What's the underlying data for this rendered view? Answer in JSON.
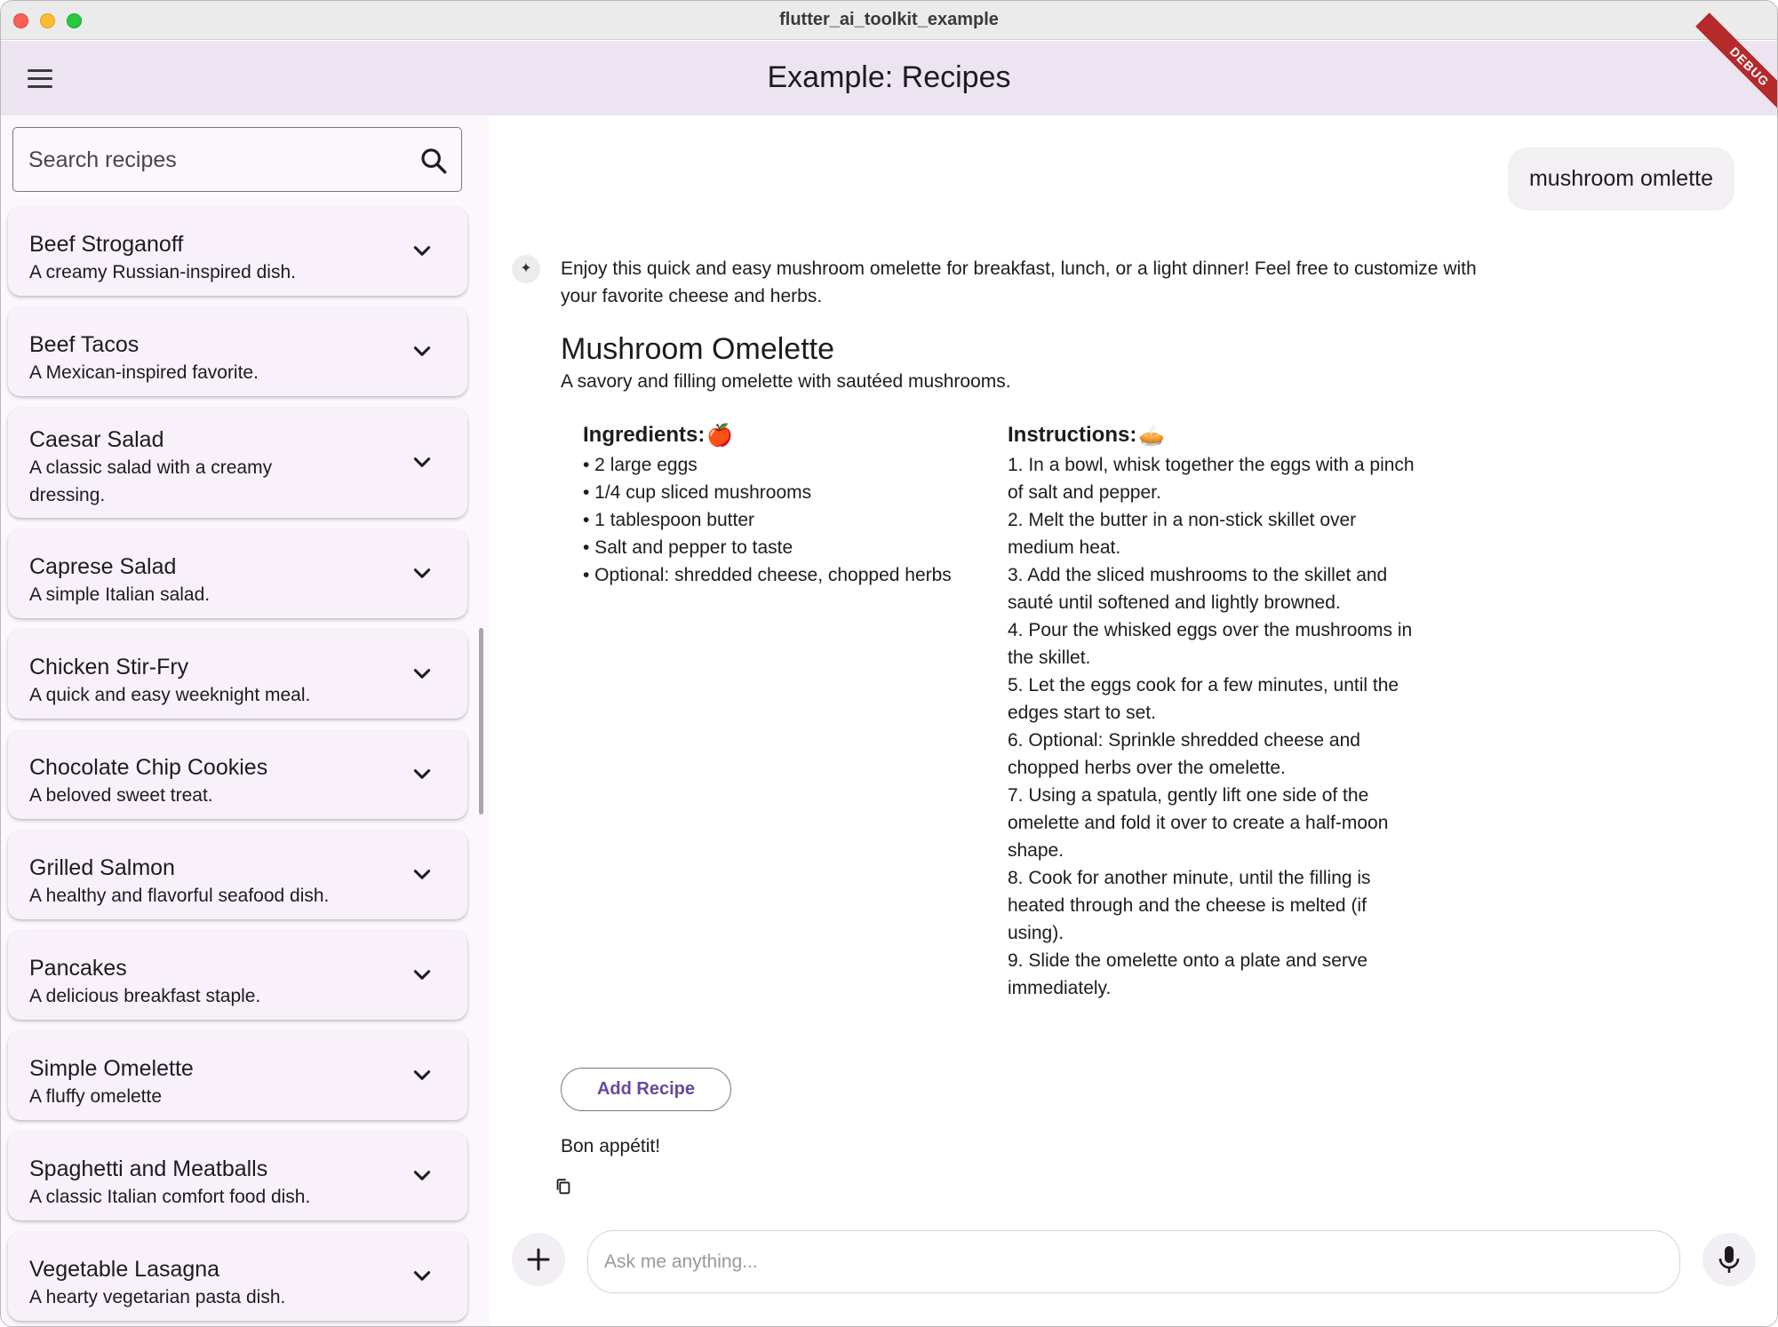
{
  "window": {
    "title": "flutter_ai_toolkit_example"
  },
  "appbar": {
    "title": "Example: Recipes",
    "debug_label": "DEBUG"
  },
  "sidebar": {
    "search_placeholder": "Search recipes",
    "recipes": [
      {
        "name": "Beef Stroganoff",
        "description": "A creamy Russian-inspired dish."
      },
      {
        "name": "Beef Tacos",
        "description": "A Mexican-inspired favorite."
      },
      {
        "name": "Caesar Salad",
        "description": "A classic salad with a creamy dressing."
      },
      {
        "name": "Caprese Salad",
        "description": "A simple Italian salad."
      },
      {
        "name": "Chicken Stir-Fry",
        "description": "A quick and easy weeknight meal."
      },
      {
        "name": "Chocolate Chip Cookies",
        "description": "A beloved sweet treat."
      },
      {
        "name": "Grilled Salmon",
        "description": "A healthy and flavorful seafood dish."
      },
      {
        "name": "Pancakes",
        "description": "A delicious breakfast staple."
      },
      {
        "name": "Simple Omelette",
        "description": "A fluffy omelette"
      },
      {
        "name": "Spaghetti and Meatballs",
        "description": "A classic Italian comfort food dish."
      },
      {
        "name": "Vegetable Lasagna",
        "description": "A hearty vegetarian pasta dish."
      }
    ]
  },
  "chat": {
    "user_message": "mushroom omlette",
    "ai_intro": "Enjoy this quick and easy mushroom omelette for breakfast, lunch, or a light dinner! Feel free to customize with your favorite cheese and herbs.",
    "recipe": {
      "title": "Mushroom Omelette",
      "description": "A savory and filling omelette with sautéed mushrooms.",
      "ingredients_heading": "Ingredients:",
      "ingredients_emoji": "🍎",
      "instructions_heading": "Instructions:",
      "instructions_emoji": "🥧",
      "ingredients": [
        "• 2 large eggs",
        "• 1/4 cup sliced mushrooms",
        "• 1 tablespoon butter",
        "• Salt and pepper to taste",
        "• Optional: shredded cheese, chopped herbs"
      ],
      "instructions": [
        "1. In a bowl, whisk together the eggs with a pinch of salt and pepper.",
        "2. Melt the butter in a non-stick skillet over medium heat.",
        "3. Add the sliced mushrooms to the skillet and sauté until softened and lightly browned.",
        "4. Pour the whisked eggs over the mushrooms in the skillet.",
        "5. Let the eggs cook for a few minutes, until the edges start to set.",
        "6. Optional: Sprinkle shredded cheese and chopped herbs over the omelette.",
        "7. Using a spatula, gently lift one side of the omelette and fold it over to create a half-moon shape.",
        "8. Cook for another minute, until the filling is heated through and the cheese is melted (if using).",
        "9. Slide the omelette onto a plate and serve immediately."
      ]
    },
    "add_recipe_label": "Add Recipe",
    "closing": "Bon appétit!",
    "input_placeholder": "Ask me anything..."
  },
  "colors": {
    "appbar_bg": "#ece5f1",
    "sidebar_bg": "#fbf7fd",
    "card_bg": "#f8f1fa",
    "accent": "#65499c",
    "debug_ribbon": "#b52a2a"
  }
}
